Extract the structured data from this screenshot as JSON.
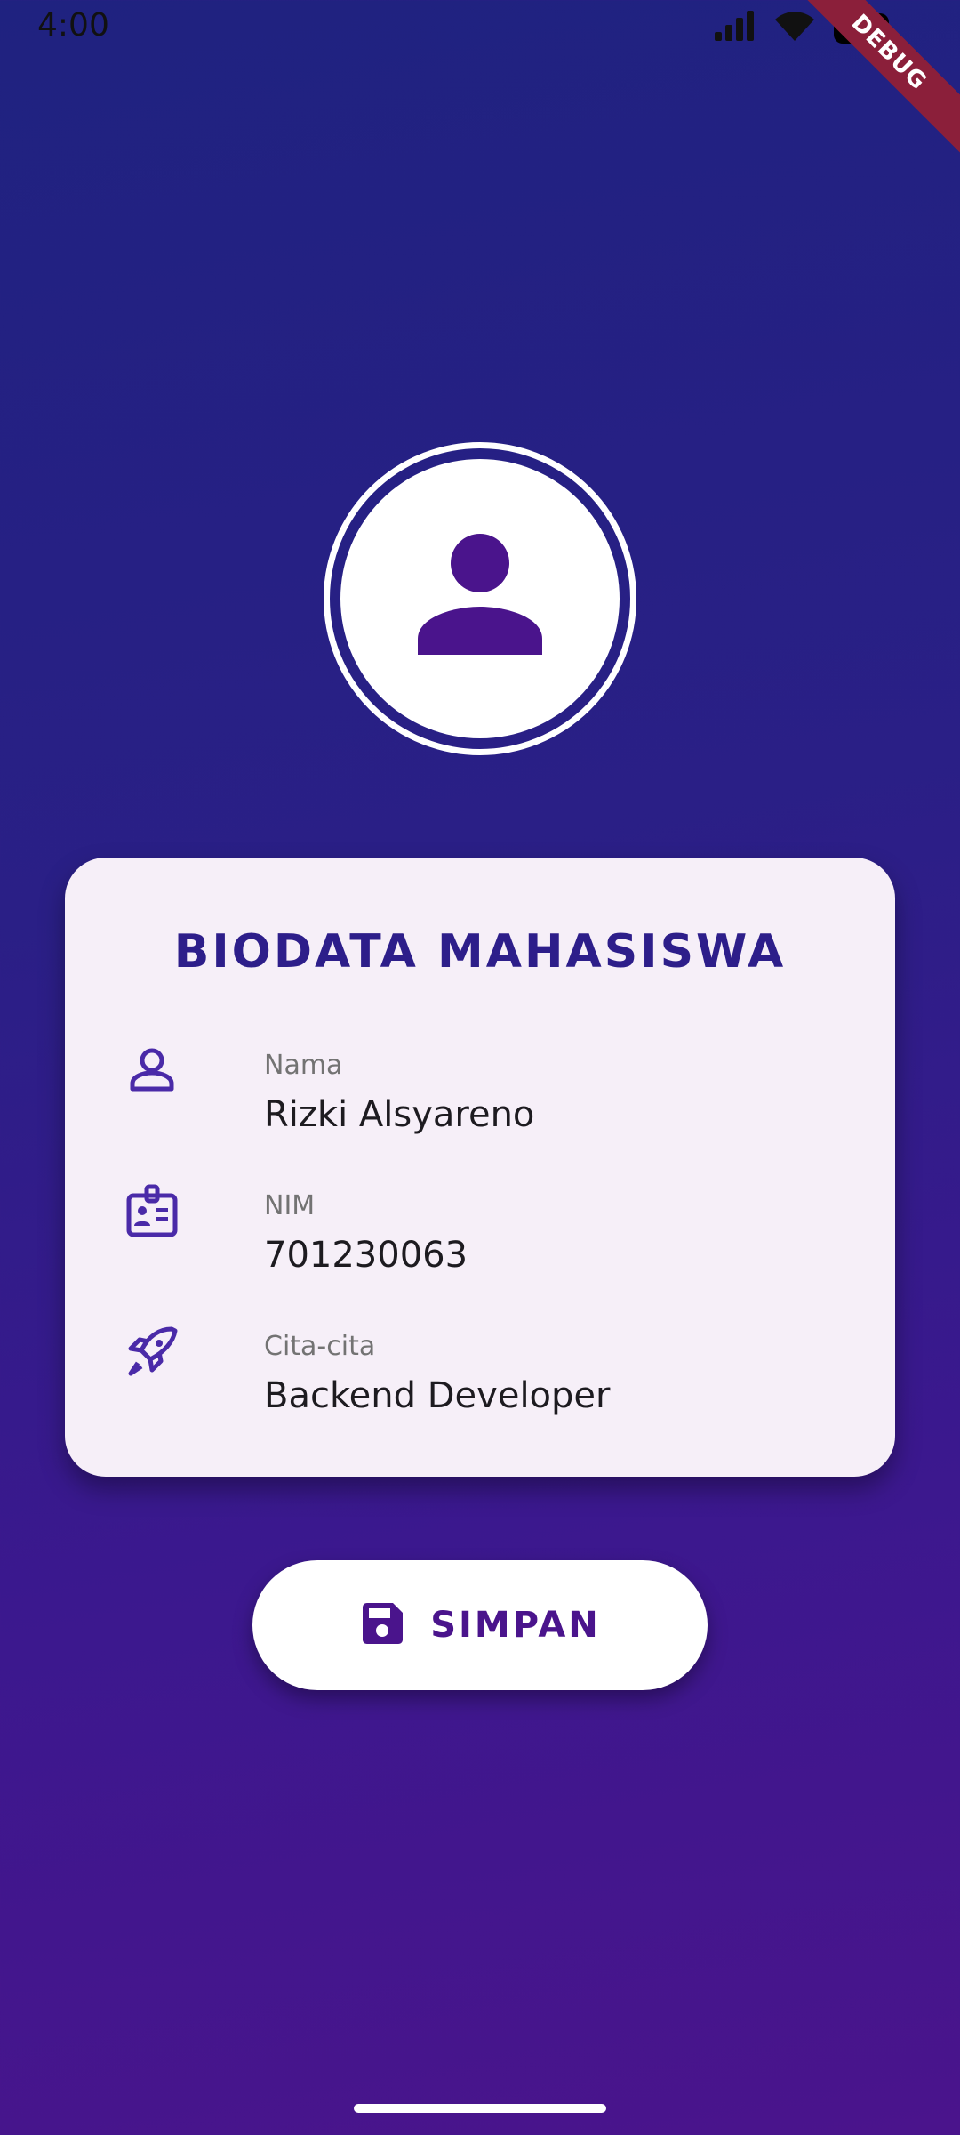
{
  "status_bar": {
    "time": "4:00",
    "icons": [
      "signal-icon",
      "wifi-icon",
      "battery-icon"
    ]
  },
  "debug_banner": "DEBUG",
  "avatar": {
    "icon": "person-icon"
  },
  "card": {
    "title": "BIODATA MAHASISWA",
    "fields": [
      {
        "icon": "person-outline-icon",
        "label": "Nama",
        "value": "Rizki Alsyareno"
      },
      {
        "icon": "id-badge-icon",
        "label": "NIM",
        "value": "701230063"
      },
      {
        "icon": "rocket-icon",
        "label": "Cita-cita",
        "value": "Backend Developer"
      }
    ]
  },
  "actions": {
    "save_icon": "save-icon",
    "save_label": "SIMPAN"
  },
  "colors": {
    "accent": "#4a148c",
    "title": "#2d1e8a",
    "card_bg": "#f6eff8",
    "gradient_top": "#1f2280",
    "gradient_bottom": "#4a148c"
  }
}
